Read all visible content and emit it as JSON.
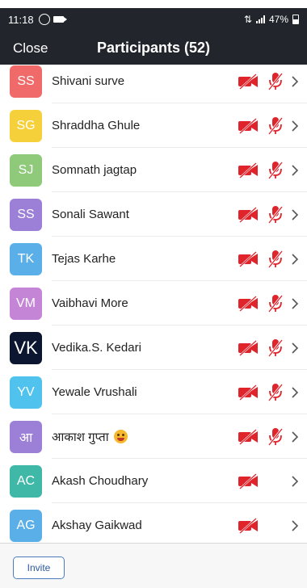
{
  "status_bar": {
    "time": "11:18",
    "battery": "47%",
    "battery_level": 0.47
  },
  "header": {
    "close_label": "Close",
    "title": "Participants (52)"
  },
  "participants": [
    {
      "initials": "SS",
      "name": "Shivani surve",
      "avatar_color": "#f06a6a",
      "video_muted": true,
      "audio_muted": true
    },
    {
      "initials": "SG",
      "name": "Shraddha Ghule",
      "avatar_color": "#f6d03a",
      "video_muted": true,
      "audio_muted": true
    },
    {
      "initials": "SJ",
      "name": "Somnath jagtap",
      "avatar_color": "#8fc97a",
      "video_muted": true,
      "audio_muted": true
    },
    {
      "initials": "SS",
      "name": "Sonali Sawant",
      "avatar_color": "#9c7fd6",
      "video_muted": true,
      "audio_muted": true
    },
    {
      "initials": "TK",
      "name": "Tejas Karhe",
      "avatar_color": "#5aafe8",
      "video_muted": true,
      "audio_muted": true
    },
    {
      "initials": "VM",
      "name": "Vaibhavi More",
      "avatar_color": "#c585d6",
      "video_muted": true,
      "audio_muted": true
    },
    {
      "initials": "VK",
      "name": "Vedika.S. Kedari",
      "avatar_color": "#0d1630",
      "video_muted": true,
      "audio_muted": true
    },
    {
      "initials": "YV",
      "name": "Yewale Vrushali",
      "avatar_color": "#4fc3ee",
      "video_muted": true,
      "audio_muted": true
    },
    {
      "initials": "आ",
      "name": "आकाश गुप्ता",
      "emoji": "grinning-tongue-emoji",
      "avatar_color": "#9c7fd6",
      "video_muted": true,
      "audio_muted": true
    },
    {
      "initials": "AC",
      "name": "Akash Choudhary",
      "avatar_color": "#3fb8a8",
      "video_muted": true,
      "audio_muted": false
    },
    {
      "initials": "AG",
      "name": "Akshay Gaikwad",
      "avatar_color": "#5aafe8",
      "video_muted": true,
      "audio_muted": false
    }
  ],
  "icons": {
    "video_muted": "video-off-icon",
    "audio_muted": "mic-off-icon",
    "row_action": "chevron-right-icon"
  },
  "colors": {
    "header_bg": "#22252c",
    "muted_red": "#e0242c",
    "invite_border": "#4b7bbf"
  },
  "footer": {
    "invite_label": "Invite"
  }
}
